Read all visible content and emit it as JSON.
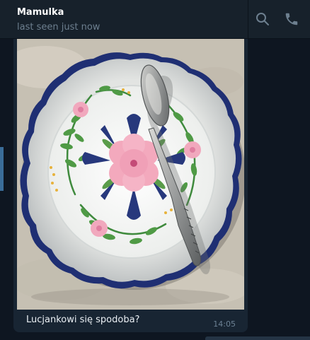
{
  "header": {
    "name": "Mamulka",
    "status": "last seen just now",
    "icons": [
      "search-icon",
      "phone-icon"
    ]
  },
  "message": {
    "caption": "Lucjankowi się spodoba?",
    "time": "14:05"
  },
  "colors": {
    "background": "#0e1621",
    "header": "#17212b",
    "bubble": "#182533",
    "accent": "#3a6d99"
  }
}
